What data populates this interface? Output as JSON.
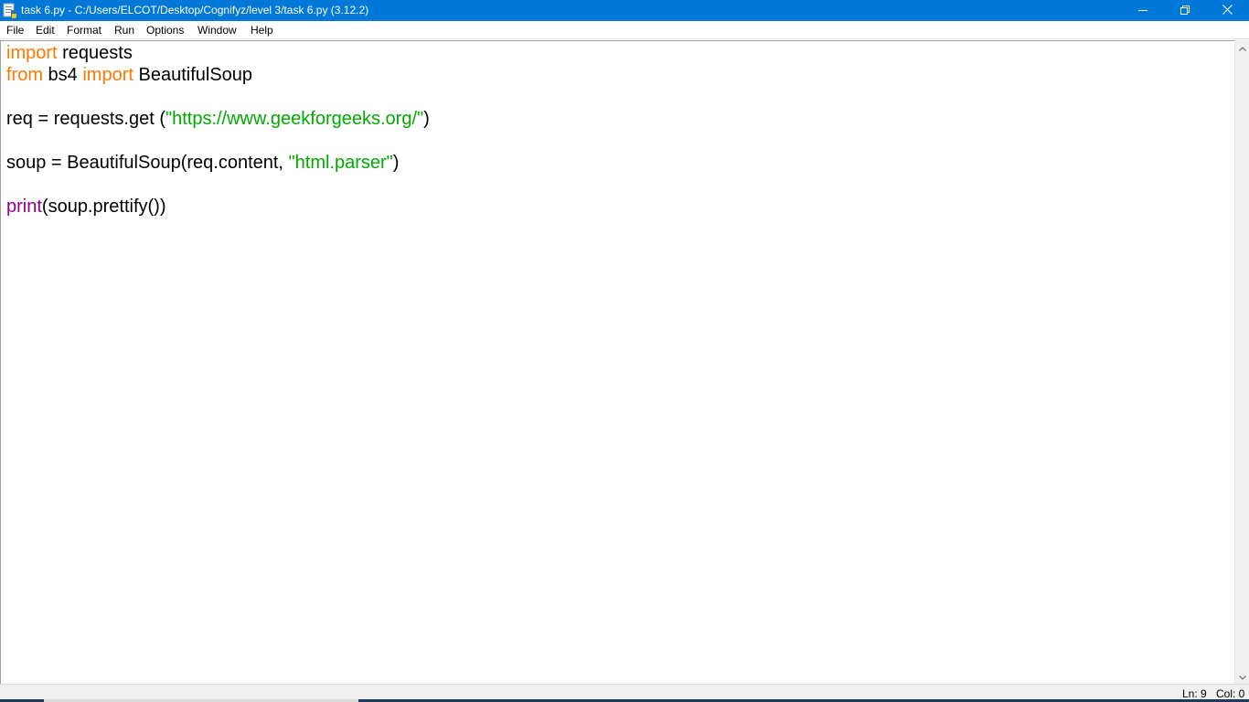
{
  "window": {
    "title": "task 6.py - C:/Users/ELCOT/Desktop/Cognifyz/level 3/task 6.py (3.12.2)",
    "icon": "python-file-icon",
    "controls": [
      "minimize-icon",
      "restore-icon",
      "close-icon"
    ],
    "title_bar_color": "#0078d7"
  },
  "menu": {
    "items": [
      "File",
      "Edit",
      "Format",
      "Run",
      "Options",
      "Window",
      "Help"
    ]
  },
  "editor": {
    "lines": [
      [
        {
          "t": "import",
          "c": "kw"
        },
        {
          "t": " requests",
          "c": ""
        }
      ],
      [
        {
          "t": "from",
          "c": "kw"
        },
        {
          "t": " bs4 ",
          "c": ""
        },
        {
          "t": "import",
          "c": "kw"
        },
        {
          "t": " BeautifulSoup",
          "c": ""
        }
      ],
      [],
      [
        {
          "t": "req = requests.get (",
          "c": ""
        },
        {
          "t": "\"https://www.geekforgeeks.org/\"",
          "c": "st"
        },
        {
          "t": ")",
          "c": ""
        }
      ],
      [],
      [
        {
          "t": "soup = BeautifulSoup(req.content, ",
          "c": ""
        },
        {
          "t": "\"html.parser\"",
          "c": "st"
        },
        {
          "t": ")",
          "c": ""
        }
      ],
      [],
      [
        {
          "t": "print",
          "c": "bi"
        },
        {
          "t": "(soup.prettify())",
          "c": ""
        }
      ]
    ],
    "colors": {
      "keyword": "#ff7700",
      "builtin": "#900090",
      "string": "#00aa00",
      "default": "#000000"
    }
  },
  "status": {
    "line": "Ln: 9",
    "col": "Col: 0"
  }
}
